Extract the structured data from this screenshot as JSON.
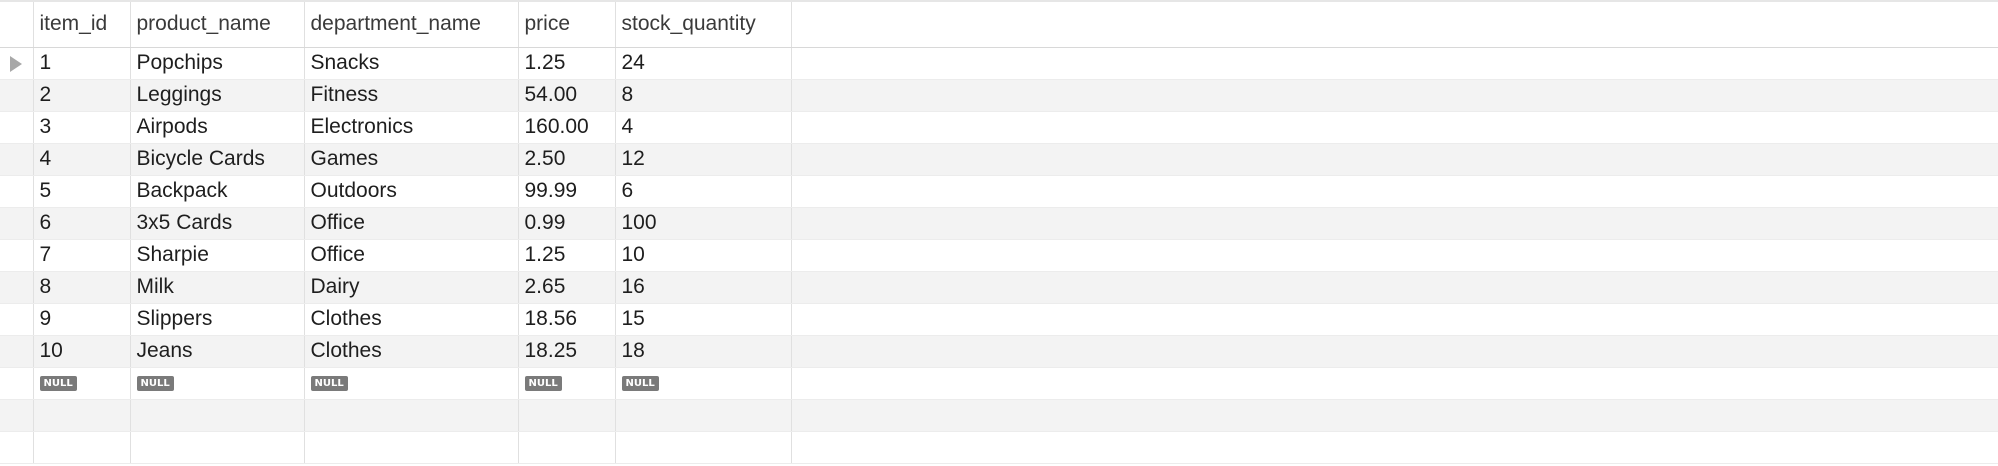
{
  "table": {
    "columns": [
      {
        "key": "item_id",
        "label": "item_id"
      },
      {
        "key": "product_name",
        "label": "product_name"
      },
      {
        "key": "department_name",
        "label": "department_name"
      },
      {
        "key": "price",
        "label": "price"
      },
      {
        "key": "stock_quantity",
        "label": "stock_quantity"
      }
    ],
    "rows": [
      {
        "item_id": "1",
        "product_name": "Popchips",
        "department_name": "Snacks",
        "price": "1.25",
        "stock_quantity": "24"
      },
      {
        "item_id": "2",
        "product_name": "Leggings",
        "department_name": "Fitness",
        "price": "54.00",
        "stock_quantity": "8"
      },
      {
        "item_id": "3",
        "product_name": "Airpods",
        "department_name": "Electronics",
        "price": "160.00",
        "stock_quantity": "4"
      },
      {
        "item_id": "4",
        "product_name": "Bicycle Cards",
        "department_name": "Games",
        "price": "2.50",
        "stock_quantity": "12"
      },
      {
        "item_id": "5",
        "product_name": "Backpack",
        "department_name": "Outdoors",
        "price": "99.99",
        "stock_quantity": "6"
      },
      {
        "item_id": "6",
        "product_name": "3x5 Cards",
        "department_name": "Office",
        "price": "0.99",
        "stock_quantity": "100"
      },
      {
        "item_id": "7",
        "product_name": "Sharpie",
        "department_name": "Office",
        "price": "1.25",
        "stock_quantity": "10"
      },
      {
        "item_id": "8",
        "product_name": "Milk",
        "department_name": "Dairy",
        "price": "2.65",
        "stock_quantity": "16"
      },
      {
        "item_id": "9",
        "product_name": "Slippers",
        "department_name": "Clothes",
        "price": "18.56",
        "stock_quantity": "15"
      },
      {
        "item_id": "10",
        "product_name": "Jeans",
        "department_name": "Clothes",
        "price": "18.25",
        "stock_quantity": "18"
      }
    ],
    "null_label": "NULL",
    "current_row_marker_icon": "row-pointer-icon"
  }
}
